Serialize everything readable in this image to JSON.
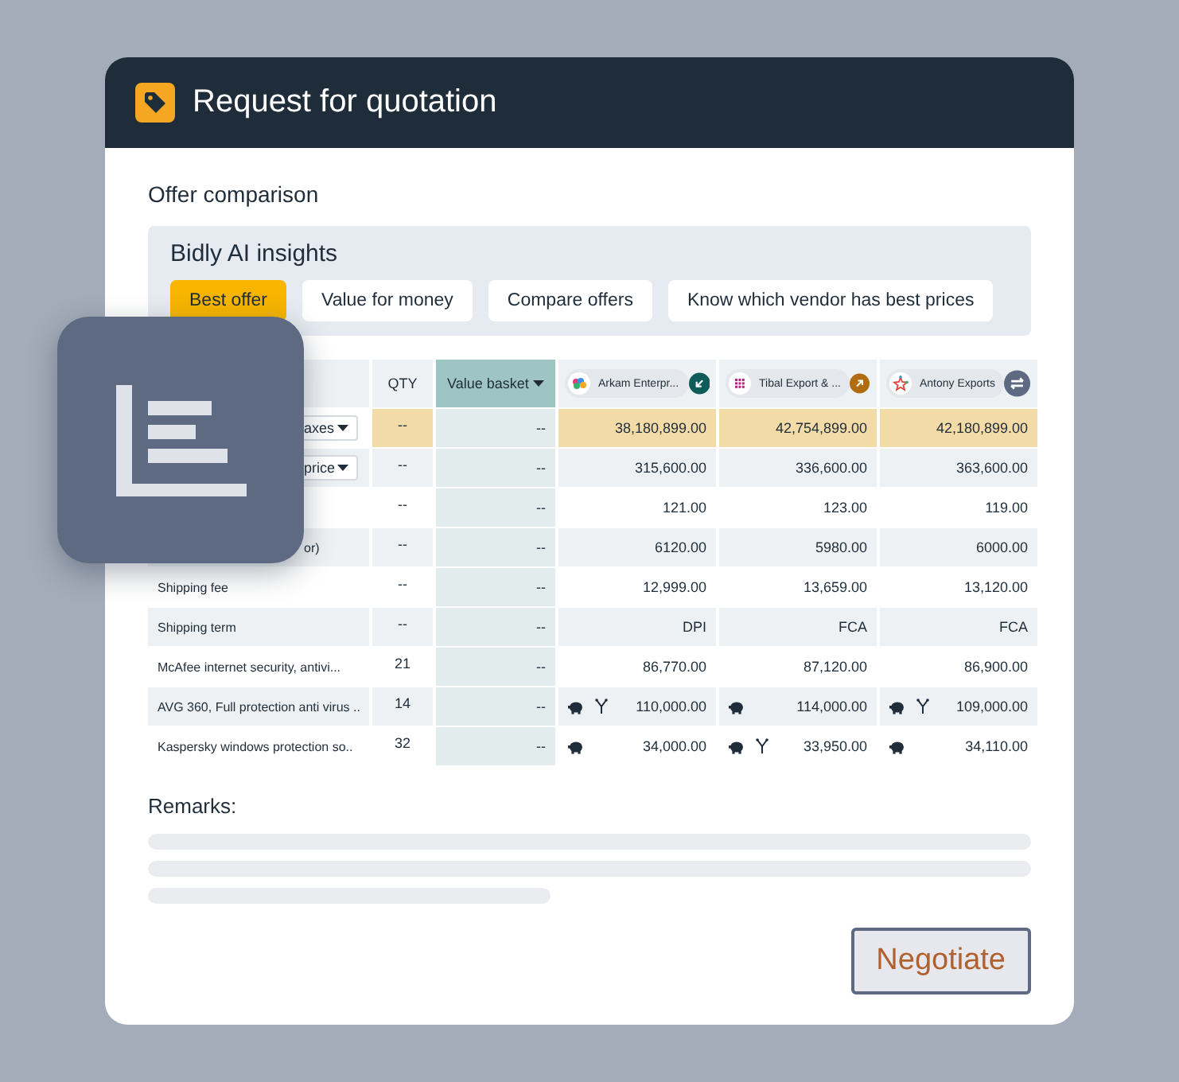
{
  "header": {
    "title": "Request for quotation"
  },
  "section_title": "Offer comparison",
  "insights": {
    "title": "Bidly AI insights",
    "chips": [
      {
        "label": "Best offer",
        "selected": true
      },
      {
        "label": "Value for money",
        "selected": false
      },
      {
        "label": "Compare offers",
        "selected": false
      },
      {
        "label": "Know which vendor has best prices",
        "selected": false
      }
    ]
  },
  "table": {
    "qty_heading": "QTY",
    "basket_heading": "Value basket",
    "vendors": [
      {
        "name": "Arkam Enterpr...",
        "kind": "down",
        "color": "#0f5d5a"
      },
      {
        "name": "Tibal Export & ...",
        "kind": "up",
        "color": "#b06c0f"
      },
      {
        "name": "Antony Exports",
        "kind": "swap",
        "color": "#5d6a82"
      }
    ],
    "rows": [
      {
        "label": "axes",
        "kind": "select",
        "highlight": true,
        "qty": "--",
        "basket": "--",
        "offers": [
          {
            "value": "38,180,899.00"
          },
          {
            "value": "42,754,899.00"
          },
          {
            "value": "42,180,899.00"
          }
        ]
      },
      {
        "label": "price",
        "kind": "select",
        "highlight": false,
        "qty": "--",
        "basket": "--",
        "offers": [
          {
            "value": "315,600.00"
          },
          {
            "value": "336,600.00"
          },
          {
            "value": "363,600.00"
          }
        ]
      },
      {
        "highlight": false,
        "qty": "--",
        "basket": "--",
        "offers": [
          {
            "value": "121.00"
          },
          {
            "value": "123.00"
          },
          {
            "value": "119.00"
          }
        ]
      },
      {
        "label": "or)",
        "kind": "clipped",
        "highlight": false,
        "qty": "--",
        "basket": "--",
        "offers": [
          {
            "value": "6120.00"
          },
          {
            "value": "5980.00"
          },
          {
            "value": "6000.00"
          }
        ]
      },
      {
        "label": "Shipping fee",
        "kind": "text",
        "highlight": false,
        "qty": "--",
        "basket": "--",
        "offers": [
          {
            "value": "12,999.00"
          },
          {
            "value": "13,659.00"
          },
          {
            "value": "13,120.00"
          }
        ]
      },
      {
        "label": "Shipping term",
        "kind": "text",
        "highlight": false,
        "qty": "--",
        "basket": "--",
        "offers": [
          {
            "value": "DPI"
          },
          {
            "value": "FCA"
          },
          {
            "value": "FCA"
          }
        ]
      },
      {
        "label": "McAfee internet security, antivi...",
        "kind": "text",
        "highlight": false,
        "qty": "21",
        "basket": "--",
        "offers": [
          {
            "value": "86,770.00"
          },
          {
            "value": "87,120.00"
          },
          {
            "value": "86,900.00"
          }
        ]
      },
      {
        "label": "AVG 360, Full protection anti virus ..",
        "kind": "text",
        "highlight": false,
        "qty": "14",
        "basket": "--",
        "offers": [
          {
            "value": "110,000.00",
            "saving": true,
            "split": true
          },
          {
            "value": "114,000.00",
            "saving": true,
            "split": false
          },
          {
            "value": "109,000.00",
            "saving": true,
            "split": true
          }
        ]
      },
      {
        "label": "Kaspersky windows protection so..",
        "kind": "text",
        "highlight": false,
        "qty": "32",
        "basket": "--",
        "offers": [
          {
            "value": "34,000.00",
            "saving": true,
            "split": false
          },
          {
            "value": "33,950.00",
            "saving": true,
            "split": true
          },
          {
            "value": "34,110.00",
            "saving": true,
            "split": false
          }
        ]
      }
    ]
  },
  "remarks": {
    "label": "Remarks:"
  },
  "actions": {
    "negotiate": "Negotiate"
  }
}
